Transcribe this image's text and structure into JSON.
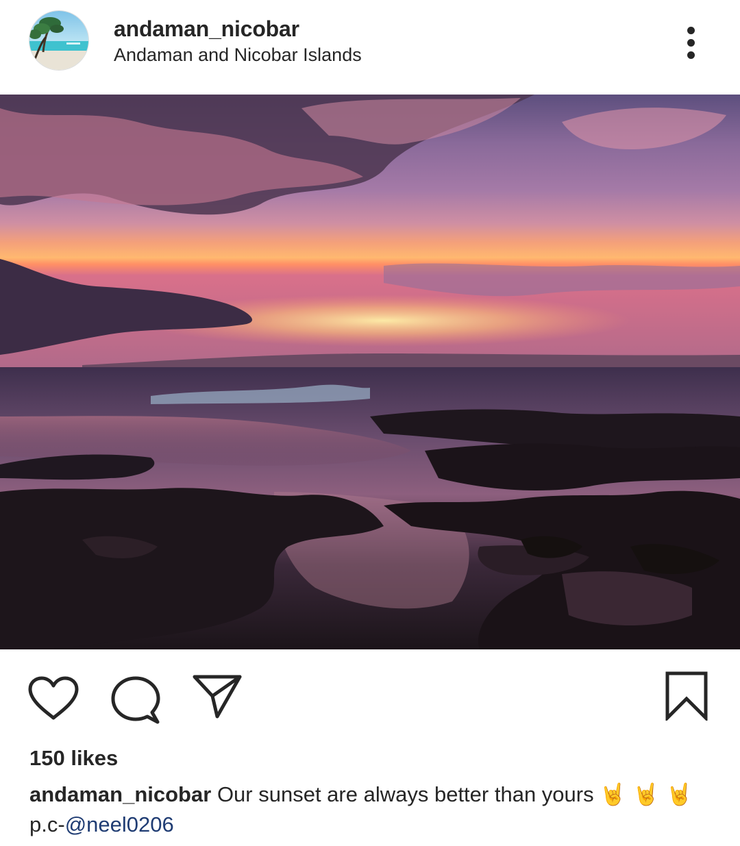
{
  "post": {
    "username": "andaman_nicobar",
    "location": "Andaman and Nicobar Islands",
    "menu_icon": "more-vertical-icon",
    "image_alt": "sunset-over-rocky-shore"
  },
  "actions": {
    "like_icon": "heart-icon",
    "comment_icon": "comment-bubble-icon",
    "share_icon": "paper-plane-icon",
    "save_icon": "bookmark-icon"
  },
  "likes": {
    "text": "150 likes"
  },
  "caption": {
    "username": "andaman_nicobar",
    "text": "Our sunset are always better than yours",
    "emojis": "🤘 🤘 🤘",
    "credit_prefix": "p.c-",
    "mention": "@neel0206"
  },
  "colors": {
    "text": "#262626",
    "mention": "#1f3c73",
    "background": "#ffffff"
  }
}
